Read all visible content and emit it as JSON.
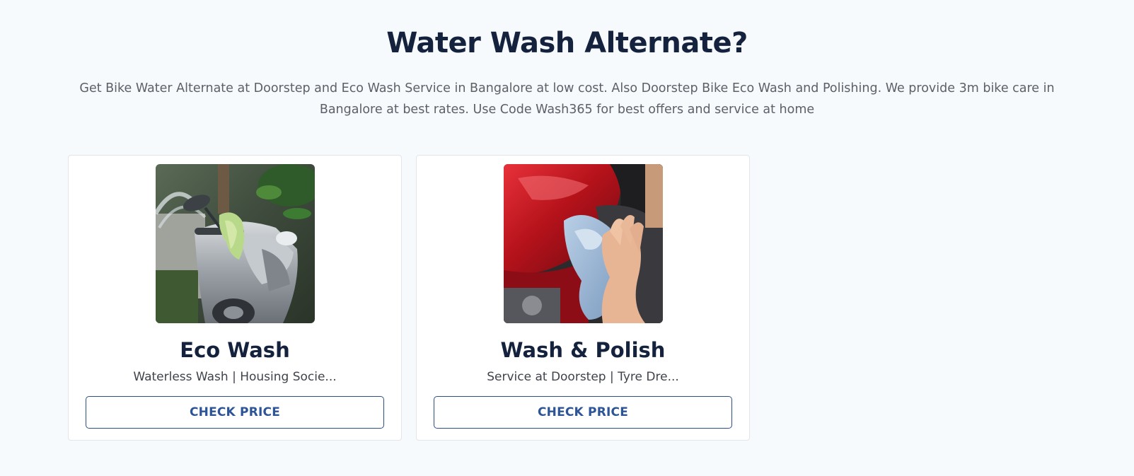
{
  "section": {
    "title": "Water Wash Alternate?",
    "description": "Get Bike Water Alternate at Doorstep and Eco Wash Service in Bangalore at low cost. Also Doorstep Bike Eco Wash and Polishing. We provide 3m bike care in Bangalore at best rates. Use Code Wash365 for best offers and service at home"
  },
  "cards": [
    {
      "title": "Eco Wash",
      "subtitle": "Waterless Wash | Housing Socie...",
      "button_label": "CHECK PRICE",
      "image": "scooter-being-washed-photo"
    },
    {
      "title": "Wash & Polish",
      "subtitle": "Service at Doorstep | Tyre Dre...",
      "button_label": "CHECK PRICE",
      "image": "red-motorcycle-polishing-photo"
    }
  ],
  "colors": {
    "page_background": "#f7fafd",
    "heading": "#14223d",
    "button_accent": "#2c5497"
  }
}
